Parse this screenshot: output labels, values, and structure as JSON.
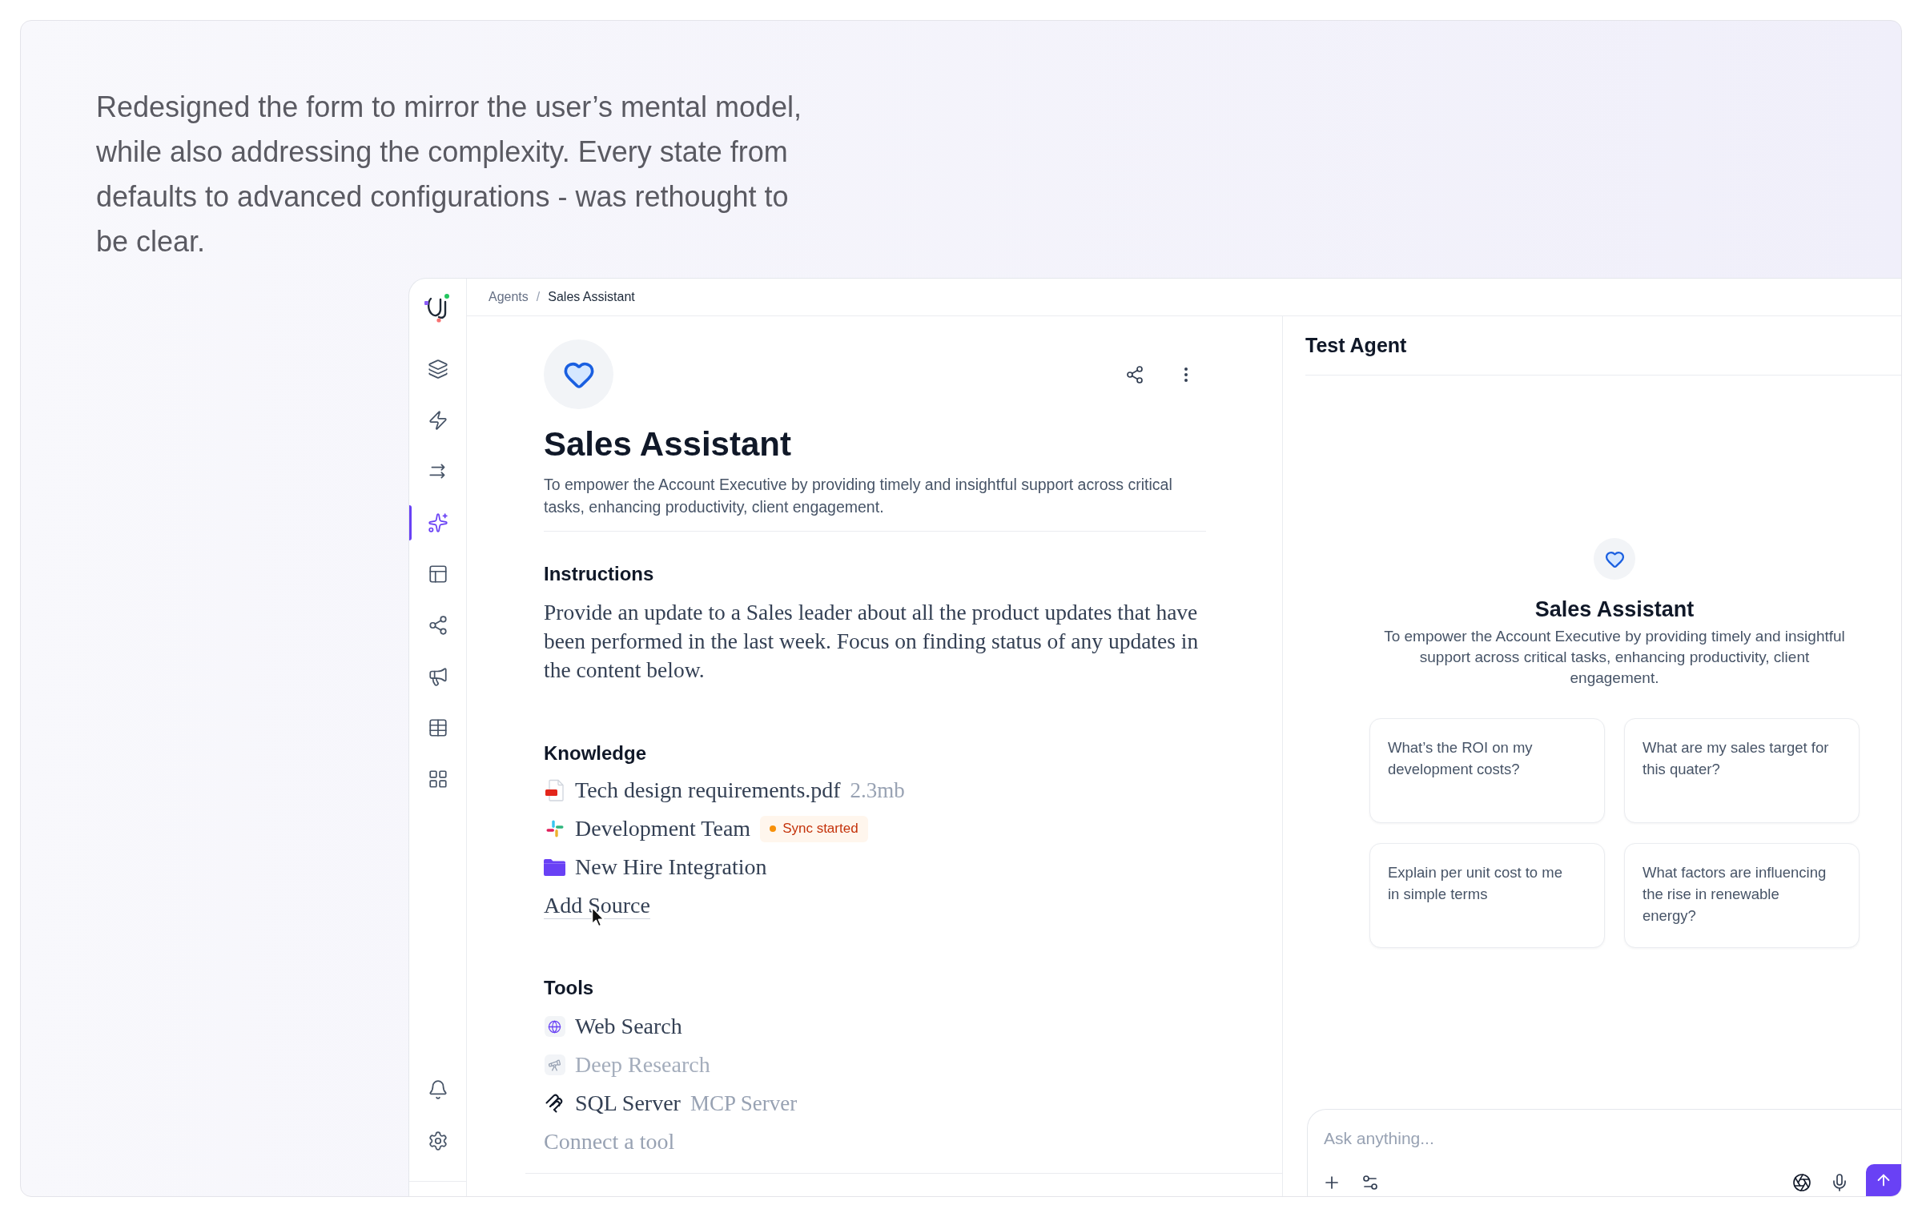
{
  "intro": {
    "text": "Redesigned the form to mirror the user’s mental model, while also addressing the complexity. Every state from defaults to advanced configurations - was rethought to be clear."
  },
  "sidebar": {
    "items": [
      {
        "selected": false
      },
      {
        "selected": false
      },
      {
        "selected": false
      },
      {
        "selected": true
      },
      {
        "selected": false
      },
      {
        "selected": false
      },
      {
        "selected": false
      },
      {
        "selected": false
      },
      {
        "selected": false
      }
    ]
  },
  "breadcrumb": {
    "items": [
      "Agents",
      "Sales Assistant"
    ],
    "separator": "/"
  },
  "agent": {
    "name": "Sales Assistant",
    "description": "To empower the Account Executive by providing timely and insightful support across critical tasks, enhancing productivity, client engagement."
  },
  "instructions": {
    "title": "Instructions",
    "text": "Provide an update to a Sales leader about all the product updates that have been performed in the last week. Focus on finding status of any updates in the content below."
  },
  "knowledge": {
    "title": "Knowledge",
    "sources": [
      {
        "kind": "pdf",
        "name": "Tech design requirements.pdf",
        "meta": "2.3mb"
      },
      {
        "kind": "chat",
        "name": "Development Team",
        "badge": {
          "label": "Sync started"
        }
      },
      {
        "kind": "folder",
        "name": "New Hire Integration"
      }
    ],
    "add_label": "Add Source"
  },
  "tools": {
    "title": "Tools",
    "items": [
      {
        "kind": "web",
        "name": "Web Search",
        "disabled": false
      },
      {
        "kind": "research",
        "name": "Deep Research",
        "disabled": true
      },
      {
        "kind": "server",
        "name": "SQL Server",
        "meta": "MCP Server",
        "disabled": false
      }
    ],
    "connect_label": "Connect a tool"
  },
  "test_panel": {
    "title": "Test Agent",
    "agent_name": "Sales Assistant",
    "description": "To empower the Account Executive by providing timely and insightful support across critical tasks, enhancing productivity, client engagement.",
    "suggestions": [
      "What’s the ROI on my development costs?",
      "What are my sales target for this quater?",
      "Explain per unit cost to me in simple terms",
      "What factors are influencing the rise in renewable energy?"
    ],
    "input": {
      "placeholder": "Ask anything..."
    }
  }
}
